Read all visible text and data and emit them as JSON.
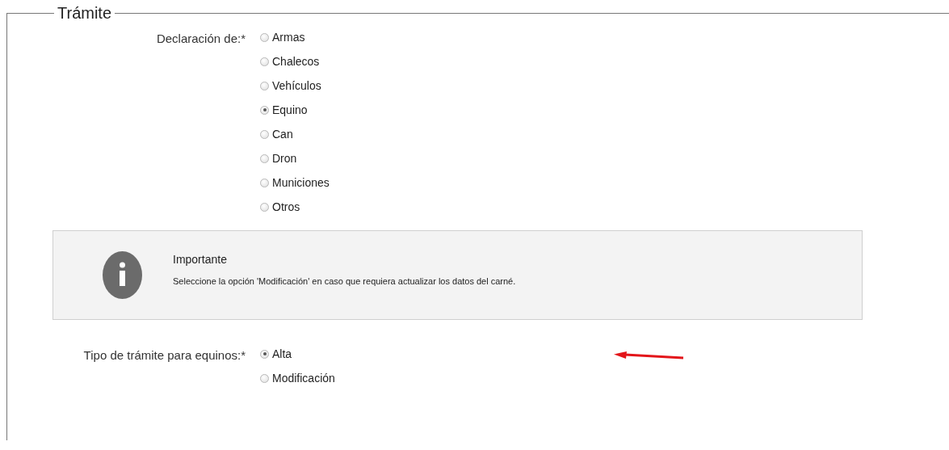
{
  "fieldset": {
    "legend": "Trámite"
  },
  "declaration": {
    "label": "Declaración de:*",
    "options": [
      {
        "label": "Armas",
        "selected": false
      },
      {
        "label": "Chalecos",
        "selected": false
      },
      {
        "label": "Vehículos",
        "selected": false
      },
      {
        "label": "Equino",
        "selected": true
      },
      {
        "label": "Can",
        "selected": false
      },
      {
        "label": "Dron",
        "selected": false
      },
      {
        "label": "Municiones",
        "selected": false
      },
      {
        "label": "Otros",
        "selected": false
      }
    ]
  },
  "notice": {
    "title": "Importante",
    "text": "Seleccione la opción 'Modificación' en caso que requiera actualizar los datos del carné."
  },
  "procedure_type": {
    "label": "Tipo de trámite para equinos:*",
    "options": [
      {
        "label": "Alta",
        "selected": true
      },
      {
        "label": "Modificación",
        "selected": false
      }
    ]
  }
}
